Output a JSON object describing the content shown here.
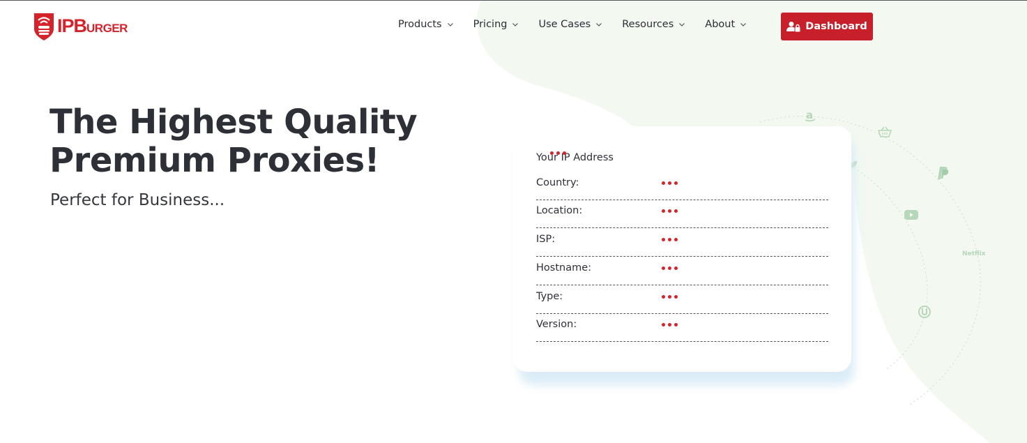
{
  "header": {
    "logo_text_main": "IPB",
    "logo_text_rest": "URGER",
    "nav": [
      {
        "label": "Products"
      },
      {
        "label": "Pricing"
      },
      {
        "label": "Use Cases"
      },
      {
        "label": "Resources"
      },
      {
        "label": "About"
      }
    ],
    "dashboard_label": "Dashboard"
  },
  "hero": {
    "title_line1": "The Highest Quality",
    "title_line2": "Premium Proxies!",
    "subtitle": "Perfect for Business..."
  },
  "ip_card": {
    "heading": "Your IP Address",
    "rows": [
      {
        "label": "Country:"
      },
      {
        "label": "Location:"
      },
      {
        "label": "ISP:"
      },
      {
        "label": "Hostname:"
      },
      {
        "label": "Type:"
      },
      {
        "label": "Version:"
      }
    ]
  },
  "orbit": {
    "netflix_label": "Netflix",
    "icons": [
      "amazon-icon",
      "basket-icon",
      "paypal-icon",
      "youtube-icon",
      "utorrent-icon",
      "leaf-icon"
    ]
  },
  "colors": {
    "brand_red": "#c8202a",
    "text_dark": "#2e3038",
    "bg_green": "#f3f9f1",
    "shadow_blue": "#d8ebf6"
  }
}
